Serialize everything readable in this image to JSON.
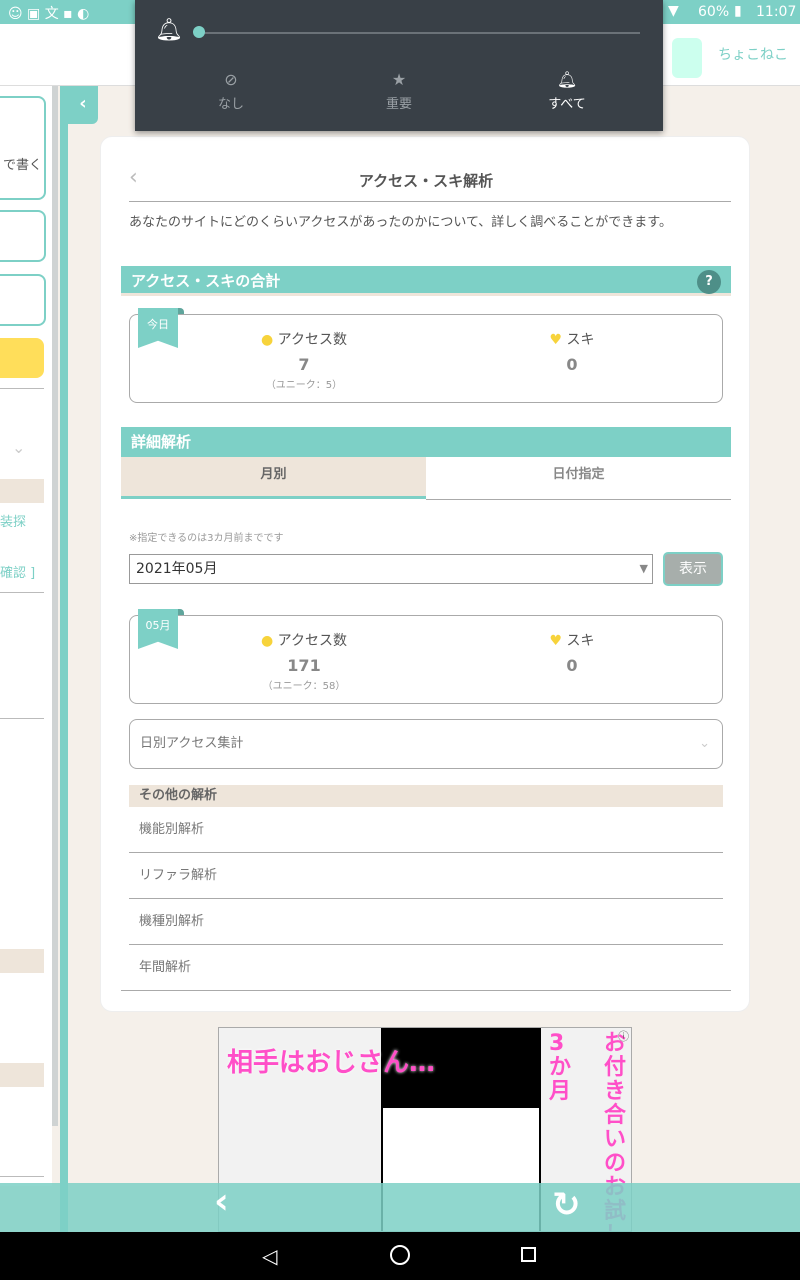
{
  "status_bar": {
    "battery": "60%",
    "time": "11:07",
    "left_icons": [
      "cat-icon",
      "badge-60-icon",
      "translate-icon",
      "image-icon",
      "app-icon"
    ]
  },
  "shade": {
    "options": [
      {
        "label": "なし",
        "icon": "block-icon"
      },
      {
        "label": "重要",
        "icon": "star-icon"
      },
      {
        "label": "すべて",
        "icon": "bell-ring-icon"
      }
    ],
    "volume": 0
  },
  "header": {
    "username": "ちょこねこ"
  },
  "sidebar": {
    "item1": "で書く",
    "link1": "装探",
    "link2": "確認 ]"
  },
  "page": {
    "title": "アクセス・スキ解析",
    "description": "あなたのサイトにどのくらいアクセスがあったのかについて、詳しく調べることができます。",
    "total_section": "アクセス・スキの合計",
    "help": "?",
    "today": {
      "ribbon": "今日",
      "access_label": "アクセス数",
      "access_value": "7",
      "unique": "（ユニーク：5）",
      "suki_label": "スキ",
      "suki_value": "0"
    },
    "detail_section": "詳細解析",
    "tabs": [
      "月別",
      "日付指定"
    ],
    "note": "※指定できるのは3カ月前までです",
    "month_select": "2021年05月",
    "show_button": "表示",
    "month": {
      "ribbon": "05月",
      "access_label": "アクセス数",
      "access_value": "171",
      "unique": "（ユニーク：58）",
      "suki_label": "スキ",
      "suki_value": "0"
    },
    "daily_dropdown": "日別アクセス集計",
    "other_section": "その他の解析",
    "other_items": [
      "機能別解析",
      "リファラ解析",
      "機種別解析",
      "年間解析"
    ]
  },
  "ad": {
    "headline": "相手はおじさん…",
    "side1": "お付き合いのお試し期間は",
    "side2": "3か月"
  }
}
